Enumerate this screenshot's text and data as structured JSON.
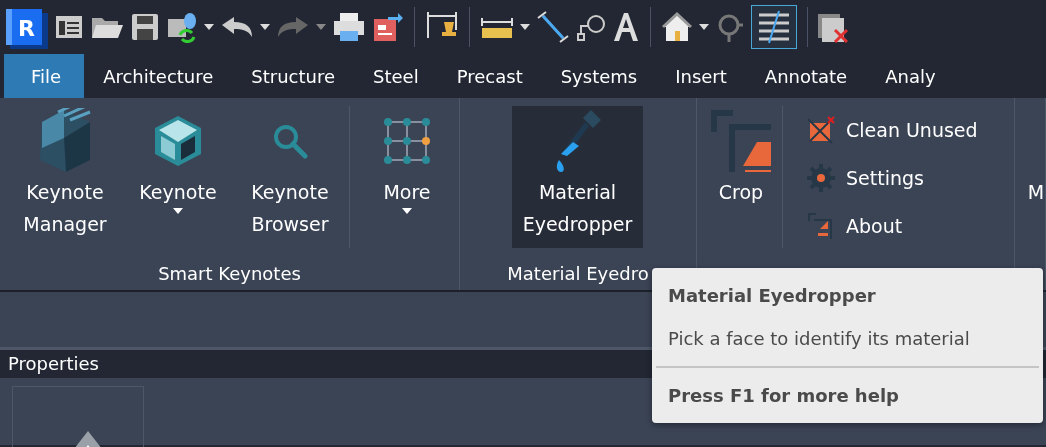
{
  "app_logo": {
    "letter": "R"
  },
  "tabs": [
    {
      "label": "File",
      "selected": true
    },
    {
      "label": "Architecture",
      "selected": false
    },
    {
      "label": "Structure",
      "selected": false
    },
    {
      "label": "Steel",
      "selected": false
    },
    {
      "label": "Precast",
      "selected": false
    },
    {
      "label": "Systems",
      "selected": false
    },
    {
      "label": "Insert",
      "selected": false
    },
    {
      "label": "Annotate",
      "selected": false
    },
    {
      "label": "Analy",
      "selected": false
    }
  ],
  "ribbon": {
    "panels": [
      {
        "title": "Smart Keynotes",
        "buttons": [
          {
            "kind": "large",
            "label": "Keynote Manager",
            "dropdown": false,
            "hovered": false
          },
          {
            "kind": "large",
            "label": "Keynote",
            "dropdown": true,
            "hovered": false
          },
          {
            "kind": "large",
            "label": "Keynote Browser",
            "dropdown": false,
            "hovered": false
          },
          {
            "kind": "separator"
          },
          {
            "kind": "large",
            "label": "More",
            "dropdown": true,
            "hovered": false
          }
        ]
      },
      {
        "title": "Material Eyedro",
        "buttons": [
          {
            "kind": "large",
            "label": "Material Eyedropper",
            "dropdown": false,
            "hovered": true
          }
        ]
      },
      {
        "buttons": [
          {
            "kind": "large",
            "label": "Crop",
            "dropdown": false,
            "hovered": false
          },
          {
            "kind": "separator"
          },
          {
            "kind": "small",
            "label": "Clean Unused"
          },
          {
            "kind": "small",
            "label": "Settings"
          },
          {
            "kind": "small",
            "label": "About"
          }
        ]
      },
      {
        "buttons": [
          {
            "kind": "large",
            "label": "M",
            "dropdown": false,
            "hovered": false
          }
        ]
      }
    ]
  },
  "properties": {
    "title": "Properties"
  },
  "tooltip": {
    "title": "Material Eyedropper",
    "description": "Pick a face to identify its material",
    "help": "Press F1 for more help"
  }
}
